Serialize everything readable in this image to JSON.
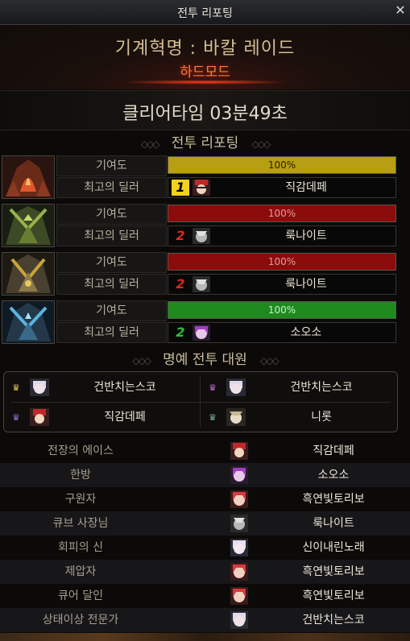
{
  "window": {
    "title": "전투 리포팅"
  },
  "header": {
    "raid_name": "기계혁명 : 바칼 레이드",
    "difficulty": "하드모드"
  },
  "clear_time": "클리어타임  03분49초",
  "report_section": {
    "title": "전투 리포팅"
  },
  "parties": [
    {
      "contribution_label": "기여도",
      "best_dealer_label": "최고의 딜러",
      "percent": "100%",
      "bar_color": "#b89e12",
      "rank": "1",
      "rank_color": "#f2d21f",
      "dealer": "직감데페"
    },
    {
      "contribution_label": "기여도",
      "best_dealer_label": "최고의 딜러",
      "percent": "100%",
      "bar_color": "#8c0b0b",
      "rank": "2",
      "rank_color": "#e0271a",
      "dealer": "룩나이트"
    },
    {
      "contribution_label": "기여도",
      "best_dealer_label": "최고의 딜러",
      "percent": "100%",
      "bar_color": "#8c0b0b",
      "rank": "2",
      "rank_color": "#e0271a",
      "dealer": "룩나이트"
    },
    {
      "contribution_label": "기여도",
      "best_dealer_label": "최고의 딜러",
      "percent": "100%",
      "bar_color": "#1e8a1e",
      "rank": "2",
      "rank_color": "#2bc43a",
      "dealer": "소오소"
    }
  ],
  "honor_section": {
    "title": "명예 전투 대원"
  },
  "honor_members": [
    "건반치는스코",
    "건반치는스코",
    "직감데페",
    "니롯"
  ],
  "awards": [
    {
      "title": "전장의 에이스",
      "player": "직감데페"
    },
    {
      "title": "한방",
      "player": "소오소"
    },
    {
      "title": "구원자",
      "player": "흑연빛토리보"
    },
    {
      "title": "큐브 사장님",
      "player": "룩나이트"
    },
    {
      "title": "회피의 신",
      "player": "신이내린노래"
    },
    {
      "title": "제압자",
      "player": "흑연빛토리보"
    },
    {
      "title": "큐어 달인",
      "player": "흑연빛토리보"
    },
    {
      "title": "상태이상 전문가",
      "player": "건반치는스코"
    }
  ]
}
